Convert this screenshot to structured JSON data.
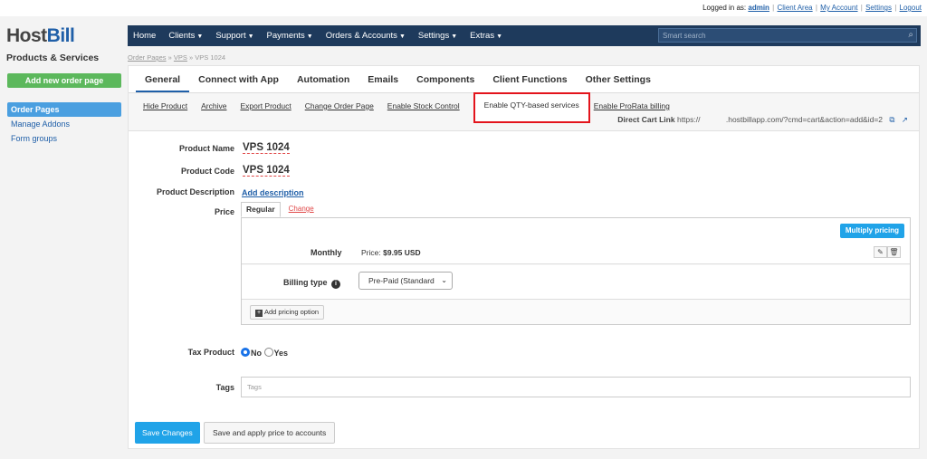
{
  "util_bar": {
    "logged_in_prefix": "Logged in as:",
    "user": "admin",
    "links": [
      "Client Area",
      "My Account",
      "Settings",
      "Logout"
    ]
  },
  "brand": {
    "host": "Host",
    "bill": "Bill"
  },
  "sidebar": {
    "title": "Products & Services",
    "add_button": "Add new order page",
    "items": [
      {
        "label": "Order Pages",
        "active": true
      },
      {
        "label": "Manage Addons",
        "active": false
      },
      {
        "label": "Form groups",
        "active": false
      }
    ]
  },
  "navbar": {
    "items": [
      "Home",
      "Clients",
      "Support",
      "Payments",
      "Orders & Accounts",
      "Settings",
      "Extras"
    ],
    "search_placeholder": "Smart search"
  },
  "breadcrumb": {
    "crumbs": [
      "Order Pages",
      "VPS",
      "VPS 1024"
    ],
    "sep": "»"
  },
  "tabs": [
    "General",
    "Connect with App",
    "Automation",
    "Emails",
    "Components",
    "Client Functions",
    "Other Settings"
  ],
  "sublinks": [
    "Hide Product",
    "Archive",
    "Export Product",
    "Change Order Page",
    "Enable Stock Control",
    "Enable QTY-based services",
    "Enable ProRata billing"
  ],
  "cart_link": {
    "label": "Direct Cart Link",
    "url_prefix": "https://",
    "url_suffix": ".hostbillapp.com/?cmd=cart&action=add&id=2"
  },
  "form": {
    "product_name_label": "Product Name",
    "product_name": "VPS 1024",
    "product_code_label": "Product Code",
    "product_code": "VPS 1024",
    "description_label": "Product Description",
    "add_description": "Add description",
    "price_label": "Price",
    "price_tab_regular": "Regular",
    "price_tab_change": "Change",
    "multiply_pricing": "Multiply pricing",
    "cycle": "Monthly",
    "price_prefix": "Price:",
    "price_value": "$9.95 USD",
    "billing_type_label": "Billing type",
    "billing_type_value": "Pre-Paid (Standard",
    "add_pricing_option": "Add pricing option",
    "tax_label": "Tax Product",
    "tax_no": "No",
    "tax_yes": "Yes",
    "tags_label": "Tags",
    "tags_placeholder": "Tags",
    "save_changes": "Save Changes",
    "save_apply": "Save and apply price to accounts"
  }
}
